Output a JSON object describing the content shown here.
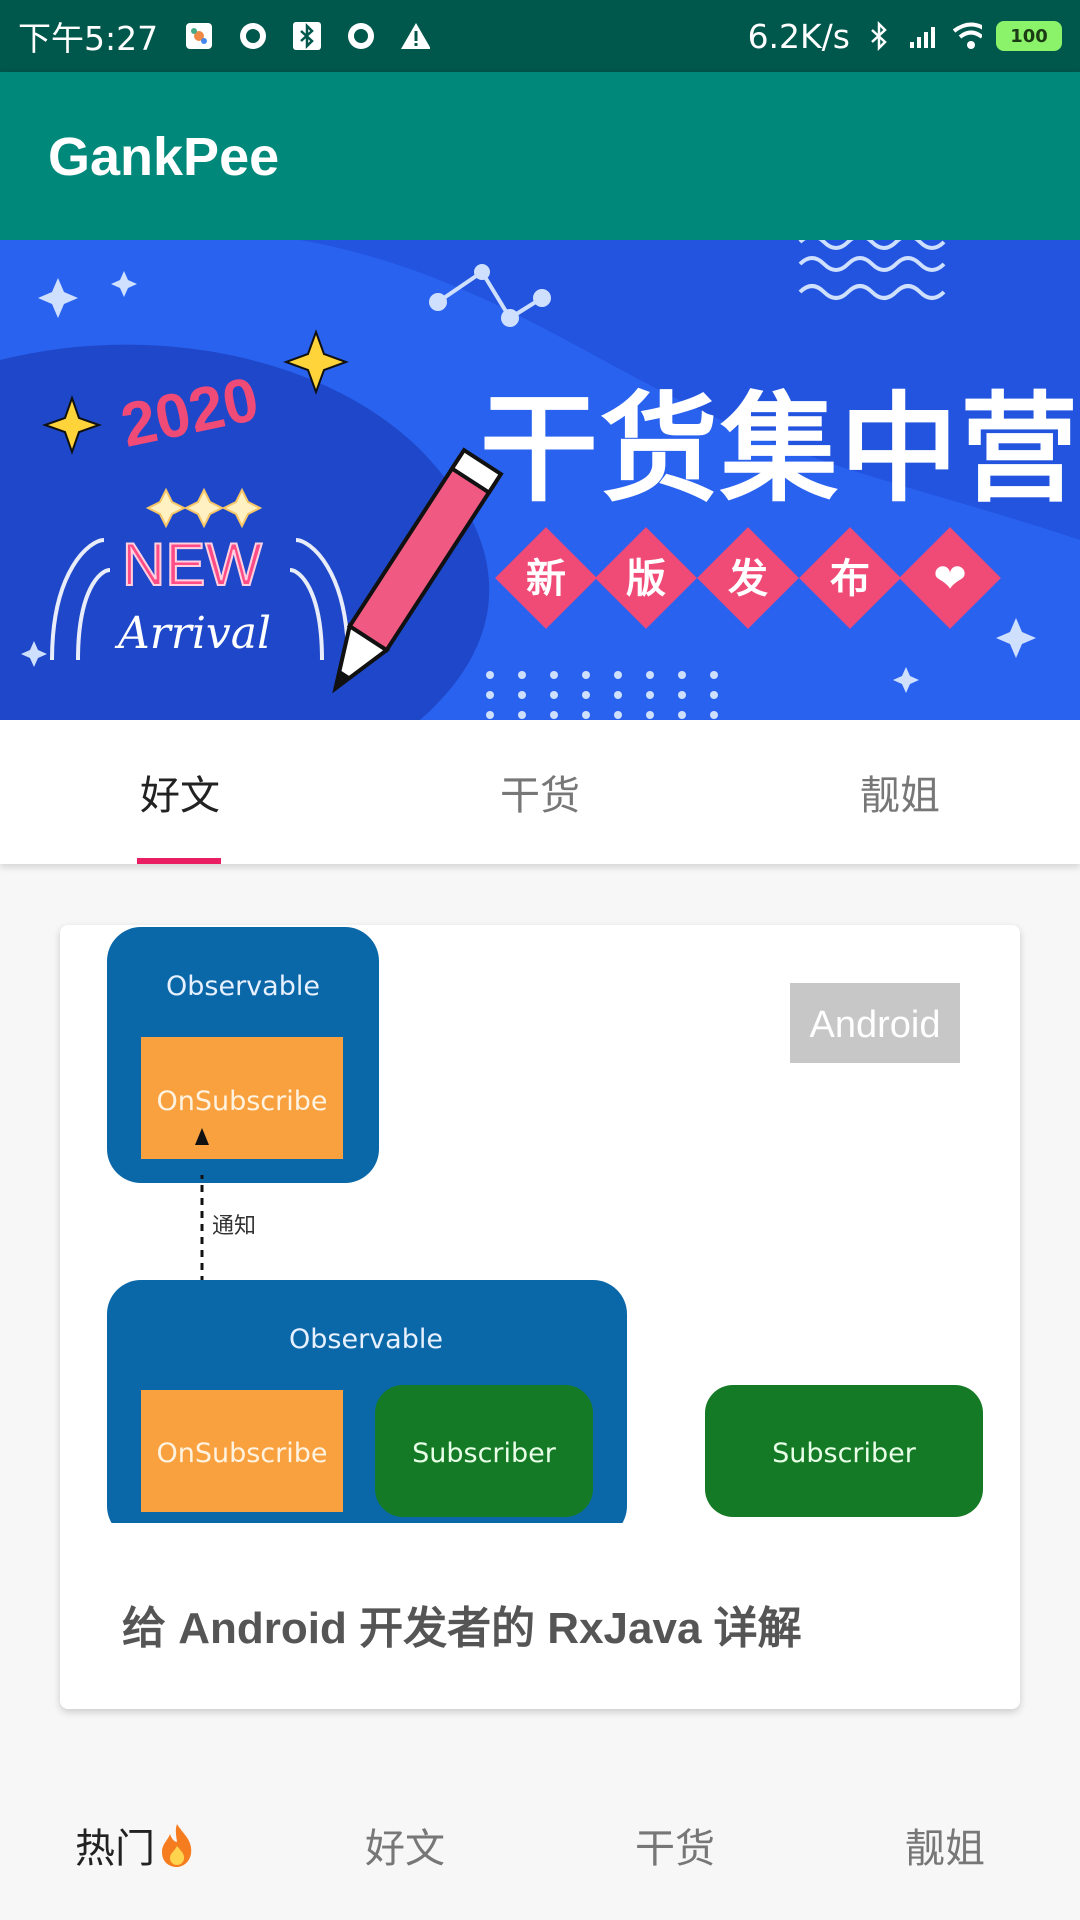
{
  "status_bar": {
    "time": "下午5:27",
    "net_speed": "6.2K/s",
    "battery": "100",
    "icons": [
      "pinwheel-icon",
      "record-icon",
      "bluetooth-icon",
      "record-icon",
      "warning-icon",
      "bluetooth-icon",
      "signal-icon",
      "wifi-icon",
      "battery-icon"
    ]
  },
  "app_bar": {
    "title": "GankPee"
  },
  "banner": {
    "year": "2020",
    "new_text": "NEW",
    "arrival_text": "Arrival",
    "headline": "干货集中营",
    "tags": [
      "新",
      "版",
      "发",
      "布",
      "❤"
    ],
    "colors": {
      "background": "#2a62f0",
      "accent": "#f04a77"
    }
  },
  "top_tabs": {
    "items": [
      {
        "label": "好文",
        "active": true
      },
      {
        "label": "干货",
        "active": false
      },
      {
        "label": "靓姐",
        "active": false
      }
    ],
    "indicator_color": "#e91e63"
  },
  "card": {
    "badge": "Android",
    "title": "给 Android 开发者的 RxJava 详解",
    "diagram": {
      "top_box": "Observable",
      "top_inner": "OnSubscribe",
      "arrow_label": "通知",
      "bottom_box": "Observable",
      "bottom_inner_left": "OnSubscribe",
      "bottom_inner_right": "Subscriber",
      "outside_box": "Subscriber"
    }
  },
  "bottom_nav": {
    "items": [
      {
        "label": "热门",
        "icon": "fire-icon",
        "active": true
      },
      {
        "label": "好文",
        "active": false
      },
      {
        "label": "干货",
        "active": false
      },
      {
        "label": "靓姐",
        "active": false
      }
    ]
  }
}
